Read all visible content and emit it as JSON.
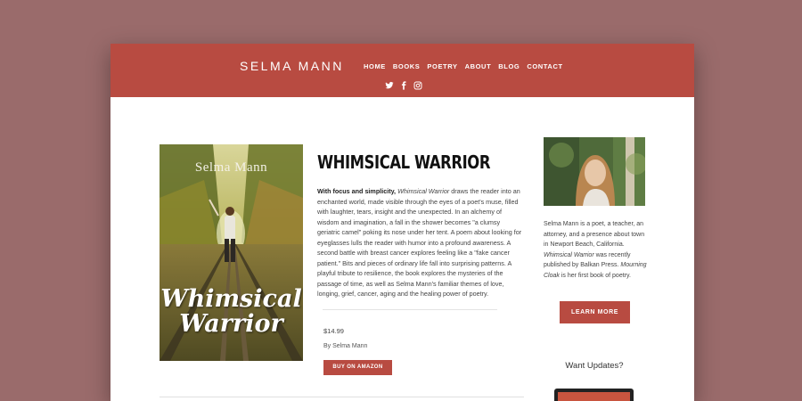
{
  "site": {
    "brand": "SELMA MANN",
    "nav": [
      "HOME",
      "BOOKS",
      "POETRY",
      "ABOUT",
      "BLOG",
      "CONTACT"
    ],
    "social_icons": [
      "twitter-icon",
      "facebook-icon",
      "instagram-icon"
    ]
  },
  "book": {
    "cover_author": "Selma Mann",
    "cover_title_line1": "Whimsical",
    "cover_title_line2": "Warrior",
    "title": "WHIMSICAL WARRIOR",
    "desc_bold": "With focus and simplicity,",
    "desc_italic": "Whimsical Warrior",
    "desc_rest": " draws the reader into an enchanted world, made visible through the eyes of a poet's muse, filled with laughter, tears, insight and the unexpected.  In an alchemy of wisdom and imagination, a fall in the shower becomes \"a clumsy geriatric camel\" poking its nose under her tent. A poem about looking for eyeglasses lulls the reader with humor into a profound awareness.  A second battle with breast cancer explores feeling like a \"fake cancer patient.\"  Bits and pieces of ordinary life fall into surprising patterns.  A playful tribute to resilience, the book explores the mysteries of the passage of time, as well as Selma Mann's familiar themes of love, longing, grief, cancer, aging and the healing power of poetry.",
    "price": "$14.99",
    "byline": "By Selma Mann",
    "buy_label": "BUY ON AMAZON"
  },
  "sidebar": {
    "bio_part1": "Selma Mann is a poet, a teacher, an attorney, and a presence about town in Newport Beach, California. ",
    "bio_italic1": "Whimsical Warrior",
    "bio_part2": " was recently published by Balkan Press. ",
    "bio_italic2": "Mourning Cloak",
    "bio_part3": " is her first book of poetry.",
    "learn_more_label": "LEARN MORE",
    "updates_heading": "Want Updates?"
  },
  "colors": {
    "accent": "#b84b41",
    "background": "#9a6b6b"
  }
}
